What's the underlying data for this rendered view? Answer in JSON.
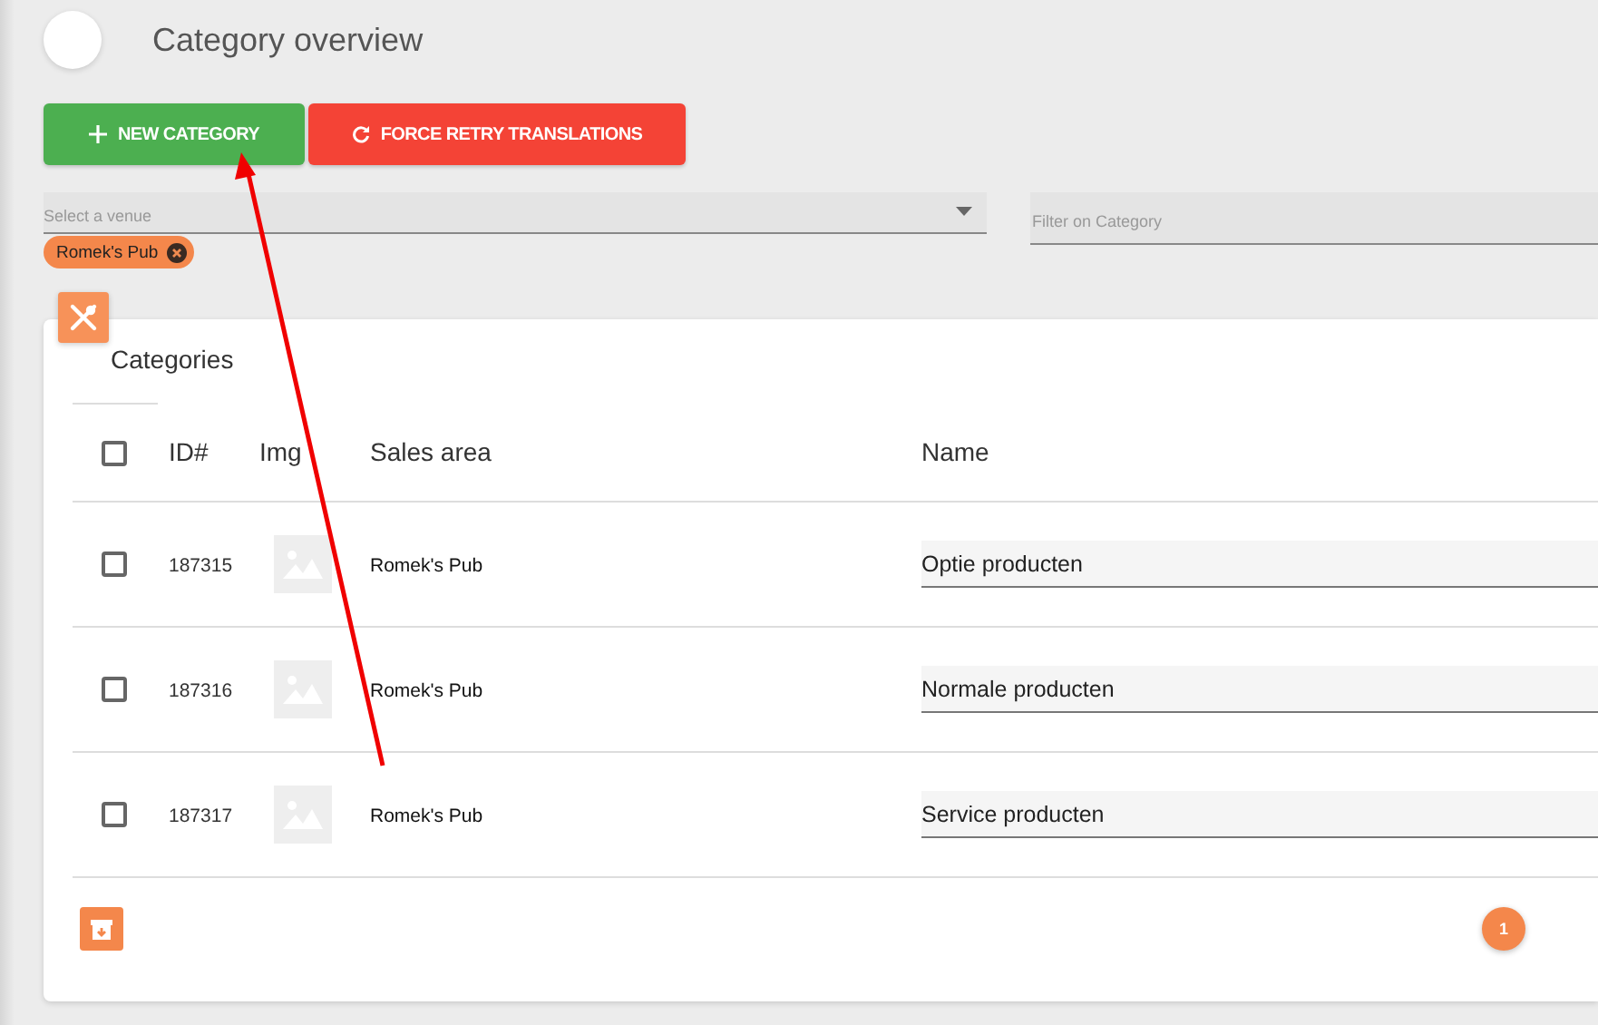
{
  "header": {
    "title": "Category overview"
  },
  "toolbar": {
    "buttons": [
      {
        "label": "NEW CATEGORY",
        "kind": "add"
      },
      {
        "label": "FORCE RETRY TRANSLATIONS",
        "kind": "retry"
      }
    ]
  },
  "filters": {
    "venue": {
      "placeholder": "Select a venue",
      "chips": [
        {
          "label": "Romek's Pub"
        }
      ]
    },
    "category": {
      "placeholder": "Filter on Category"
    }
  },
  "card": {
    "tab": "Categories",
    "select_all": {
      "checked": false
    },
    "columns": [
      "ID#",
      "Img",
      "Sales area",
      "Name"
    ],
    "rows": [
      {
        "id": "187315",
        "sales_area": "Romek's Pub",
        "name": "Optie producten",
        "checked": false
      },
      {
        "id": "187316",
        "sales_area": "Romek's Pub",
        "name": "Normale producten",
        "checked": false
      },
      {
        "id": "187317",
        "sales_area": "Romek's Pub",
        "name": "Service producten",
        "checked": false
      }
    ],
    "pagination": [
      {
        "label": "1",
        "selected": true
      }
    ]
  }
}
